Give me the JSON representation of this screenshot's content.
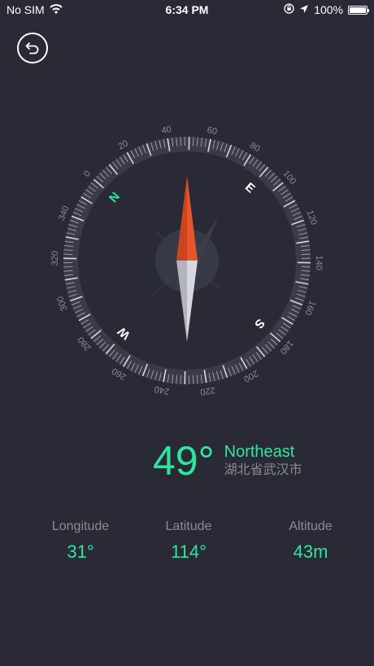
{
  "status_bar": {
    "carrier": "No SIM",
    "time": "6:34 PM",
    "battery": "100%",
    "battery_level": 1.0
  },
  "compass": {
    "heading_deg": 49,
    "cardinals": [
      "N",
      "E",
      "S",
      "W"
    ],
    "degree_labels": [
      "0",
      "20",
      "40",
      "60",
      "80",
      "100",
      "120",
      "140",
      "160",
      "180",
      "200",
      "220",
      "240",
      "260",
      "280",
      "300",
      "320",
      "340"
    ],
    "accent_color": "#2ee6a0",
    "needle_north_color": "#e8542c",
    "needle_south_color": "#d8d8e0"
  },
  "readout": {
    "heading": "49°",
    "direction": "Northeast",
    "location": "湖北省武汉市"
  },
  "stats": [
    {
      "label": "Longitude",
      "value": "31°"
    },
    {
      "label": "Latitude",
      "value": "114°"
    },
    {
      "label": "Altitude",
      "value": "43m"
    }
  ]
}
